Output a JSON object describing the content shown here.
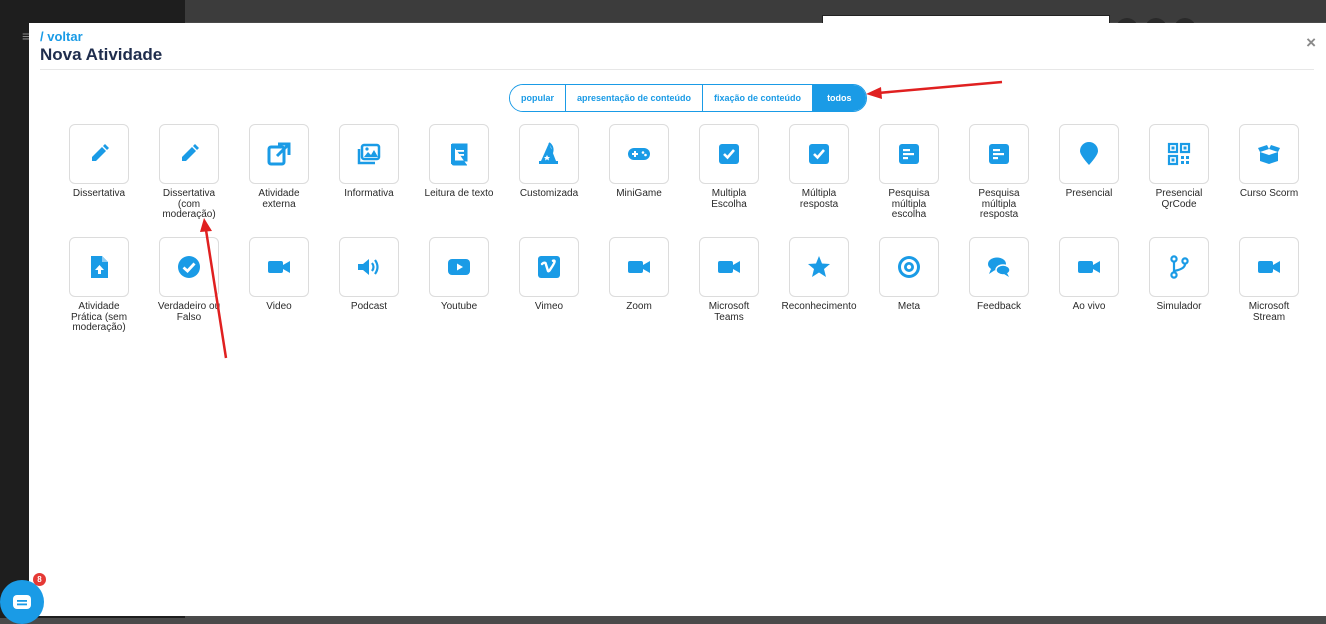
{
  "header": {
    "back_label": "/ voltar",
    "title": "Nova Atividade",
    "close_label": "×"
  },
  "filters": [
    {
      "label": "popular",
      "active": false
    },
    {
      "label": "apresentação de conteúdo",
      "active": false
    },
    {
      "label": "fixação de conteúdo",
      "active": false
    },
    {
      "label": "todos",
      "active": true
    }
  ],
  "activities_row1": [
    {
      "label": "Dissertativa",
      "icon": "pencil-icon"
    },
    {
      "label": "Dissertativa\n(com\nmoderação)",
      "icon": "pencil-icon"
    },
    {
      "label": "Atividade\nexterna",
      "icon": "external-link-icon"
    },
    {
      "label": "Informativa",
      "icon": "images-icon"
    },
    {
      "label": "Leitura de texto",
      "icon": "book-icon"
    },
    {
      "label": "Customizada",
      "icon": "wizard-hat-icon"
    },
    {
      "label": "MiniGame",
      "icon": "gamepad-icon"
    },
    {
      "label": "Multipla\nEscolha",
      "icon": "check-square-icon"
    },
    {
      "label": "Múltipla\nresposta",
      "icon": "check-square-icon"
    },
    {
      "label": "Pesquisa\nmúltipla\nescolha",
      "icon": "poll-icon"
    },
    {
      "label": "Pesquisa\nmúltipla\nresposta",
      "icon": "poll-icon"
    },
    {
      "label": "Presencial",
      "icon": "map-pin-icon"
    },
    {
      "label": "Presencial\nQrCode",
      "icon": "qrcode-icon"
    },
    {
      "label": "Curso Scorm",
      "icon": "box-open-icon"
    }
  ],
  "activities_row2": [
    {
      "label": "Atividade\nPrática (sem\nmoderação)",
      "icon": "file-upload-icon"
    },
    {
      "label": "Verdadeiro ou\nFalso",
      "icon": "check-circle-icon"
    },
    {
      "label": "Video",
      "icon": "video-icon"
    },
    {
      "label": "Podcast",
      "icon": "volume-icon"
    },
    {
      "label": "Youtube",
      "icon": "youtube-icon"
    },
    {
      "label": "Vimeo",
      "icon": "vimeo-icon"
    },
    {
      "label": "Zoom",
      "icon": "video-icon"
    },
    {
      "label": "Microsoft\nTeams",
      "icon": "video-icon"
    },
    {
      "label": "Reconhecimento",
      "icon": "star-icon"
    },
    {
      "label": "Meta",
      "icon": "target-icon"
    },
    {
      "label": "Feedback",
      "icon": "comments-icon"
    },
    {
      "label": "Ao vivo",
      "icon": "video-icon"
    },
    {
      "label": "Simulador",
      "icon": "code-branch-icon"
    },
    {
      "label": "Microsoft\nStream",
      "icon": "video-icon"
    }
  ],
  "chat": {
    "badge": "8"
  },
  "colors": {
    "accent": "#1a9be6",
    "title": "#1f2d4d",
    "annotation": "#e02020"
  }
}
